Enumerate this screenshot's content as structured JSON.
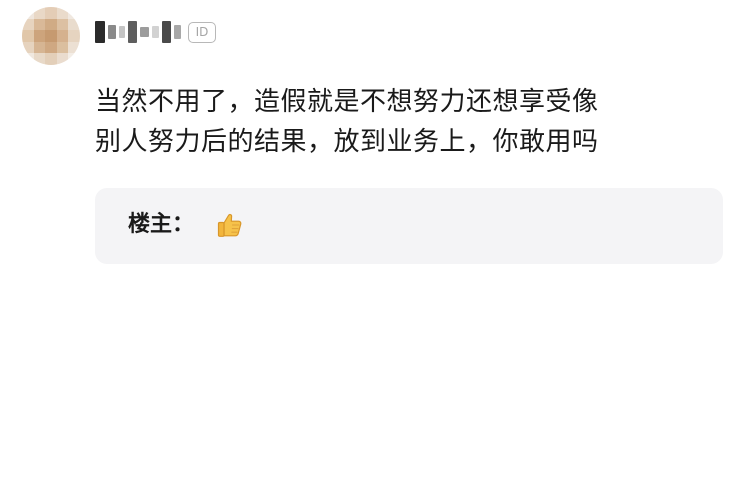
{
  "comment": {
    "id_badge": "ID",
    "text_lines": [
      "当然不用了，造假就是不想努力还想享受像",
      "别人努力后的结果，放到业务上，你敢用吗"
    ]
  },
  "reply": {
    "author_label": "楼主：",
    "content_icon": "thumbs-up-emoji"
  }
}
